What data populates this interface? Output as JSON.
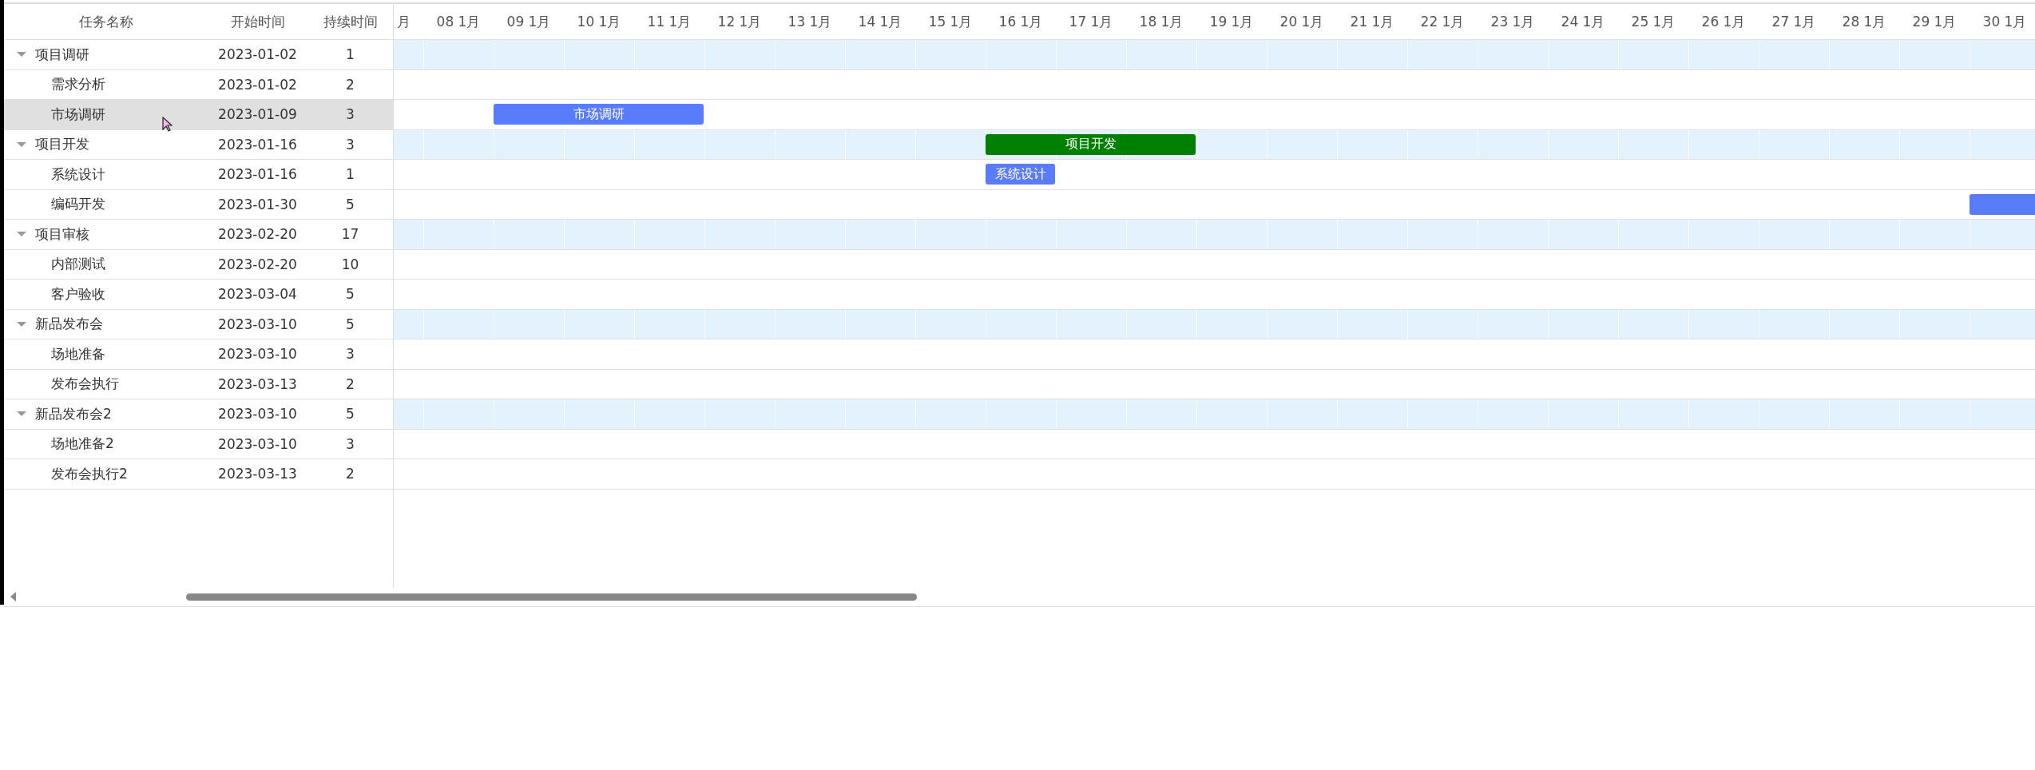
{
  "grid": {
    "columns": [
      "任务名称",
      "开始时间",
      "持续时间"
    ],
    "rows": [
      {
        "name": "项目调研",
        "start": "2023-01-02",
        "duration": "1",
        "expanded": true,
        "selected": false,
        "children": [
          {
            "name": "需求分析",
            "start": "2023-01-02",
            "duration": "2",
            "selected": false
          },
          {
            "name": "市场调研",
            "start": "2023-01-09",
            "duration": "3",
            "selected": true,
            "bar": {
              "label": "市场调研",
              "color": "#587cfb"
            }
          }
        ]
      },
      {
        "name": "项目开发",
        "start": "2023-01-16",
        "duration": "3",
        "expanded": true,
        "selected": false,
        "bar": {
          "label": "项目开发",
          "color": "#008000"
        },
        "children": [
          {
            "name": "系统设计",
            "start": "2023-01-16",
            "duration": "1",
            "selected": false,
            "bar": {
              "label": "系统设计",
              "color": "#587cfb"
            }
          },
          {
            "name": "编码开发",
            "start": "2023-01-30",
            "duration": "5",
            "selected": false,
            "bar": {
              "color": "#587cfb"
            }
          }
        ]
      },
      {
        "name": "项目审核",
        "start": "2023-02-20",
        "duration": "17",
        "expanded": true,
        "selected": false,
        "children": [
          {
            "name": "内部测试",
            "start": "2023-02-20",
            "duration": "10",
            "selected": false
          },
          {
            "name": "客户验收",
            "start": "2023-03-04",
            "duration": "5",
            "selected": false
          }
        ]
      },
      {
        "name": "新品发布会",
        "start": "2023-03-10",
        "duration": "5",
        "expanded": true,
        "selected": false,
        "children": [
          {
            "name": "场地准备",
            "start": "2023-03-10",
            "duration": "3",
            "selected": false
          },
          {
            "name": "发布会执行",
            "start": "2023-03-13",
            "duration": "2",
            "selected": false
          }
        ]
      },
      {
        "name": "新品发布会2",
        "start": "2023-03-10",
        "duration": "5",
        "expanded": true,
        "selected": false,
        "children": [
          {
            "name": "场地准备2",
            "start": "2023-03-10",
            "duration": "3",
            "selected": false
          },
          {
            "name": "发布会执行2",
            "start": "2023-03-13",
            "duration": "2",
            "selected": false
          }
        ]
      }
    ]
  },
  "timeline": {
    "columns": [
      "月",
      "08 1月",
      "09 1月",
      "10 1月",
      "11 1月",
      "12 1月",
      "13 1月",
      "14 1月",
      "15 1月",
      "16 1月",
      "17 1月",
      "18 1月",
      "19 1月",
      "20 1月",
      "21 1月",
      "22 1月",
      "23 1月",
      "24 1月",
      "25 1月",
      "26 1月",
      "27 1月",
      "28 1月",
      "29 1月",
      "30 1月"
    ]
  }
}
